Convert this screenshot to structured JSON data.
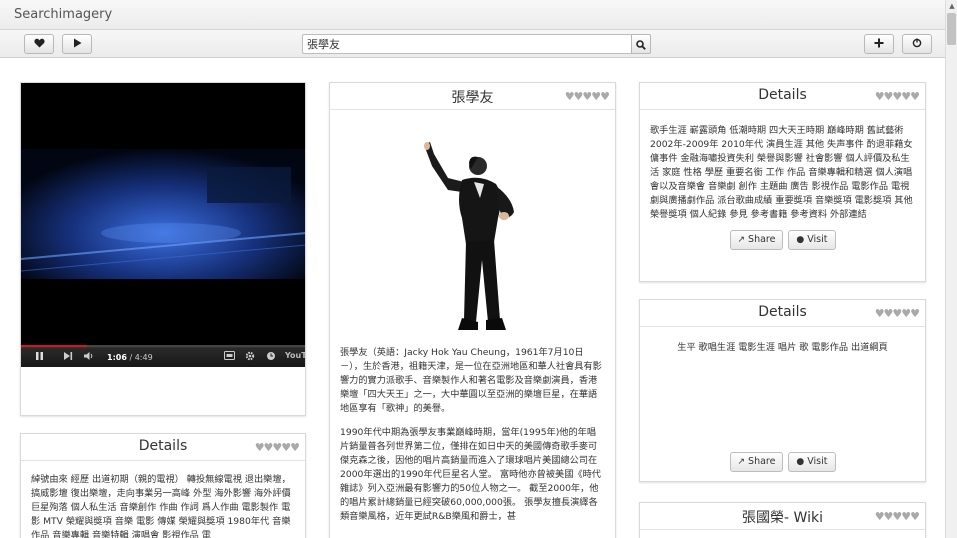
{
  "app": {
    "title": "Searchimagery"
  },
  "toolbar": {
    "like_icon": "heart-icon",
    "play_icon": "play-icon",
    "search_value": "張學友",
    "search_icon": "search-icon",
    "add_icon": "plus-icon",
    "power_icon": "power-icon"
  },
  "video": {
    "current_time": "1:06",
    "duration": "4:49",
    "separator": " / ",
    "progress": 0.23,
    "brand": "YouTube"
  },
  "panels": {
    "left_details": {
      "title": "Details",
      "text": "綽號由來 經歷 出道初期（親的電視） 轉投無線電視 退出樂壇，搞威影壇 復出樂壇，走向事業另一高峰 外型 海外影響 海外評價 巨星殉落 個人私生活 音樂創作 作曲 作詞 爲人作曲 電影製作 電影 MTV 榮耀與獎項 音樂 電影 傳媒 榮耀與獎項 1980年代 音樂作品 音樂專輯 音樂特輯 演唱會 影視作品 電"
    },
    "center": {
      "title": "張學友",
      "para1": "張學友（英語：Jacky Hok Yau Cheung，1961年7月10日－），生於香港，祖籍天津，是一位在亞洲地區和華人社會具有影響力的實力派歌手、音樂製作人和著名電影及音樂劇演員，香港樂壇「四大天王」之一，大中華圓以至亞洲的樂壇巨星，在華語地區享有「歌神」的美譽。",
      "para2": "1990年代中期為張學友事業巔峰時期，當年(1995年)他的年唱片銷量普各列世界第二位，僅排在如日中天的美國傳奇歌手麥可 傑克森之後，因他的唱片高銷量而進入了環球唱片美國總公司在2000年選出的1990年代巨星名人堂。 富時他亦曾被美國《時代雜誌》列入亞洲最有影響力的50位人物之一。 截至2000年，他的唱片累計總銷量已經突破60,000,000張。 張學友擅長演繹各類音樂風格，近年更試R&B樂風和爵士，甚"
    },
    "right_details_1": {
      "title": "Details",
      "text": "歌手生涯 嶄露頭角 低潮時期 四大天王時期 巔峰時期 舊試藝術 2002年-2009年 2010年代 演員生涯 其他 失声事件 酌退菲藉女傭事件 金融海嘯投資失利 榮譽與影響 社會影響 個人評價及私生活 家庭 性格 學歷 重要名銜 工作 作品 音樂專輯和精選 個人演唱會以及音樂會 音樂劇 創作 主題曲 廣告 影視作品 電影作品 電視劇與廣播劇作品 派台歌曲成績 重要獎項 音樂獎項 電影獎項 其他榮譽獎項 個人紀錄 參見 參考書籍 參考資料 外部連結",
      "share": "Share",
      "visit": "Visit"
    },
    "right_details_2": {
      "title": "Details",
      "text": "生平 歌唱生涯 電影生涯 唱片 歌 電影作品 出道綱頁",
      "share": "Share",
      "visit": "Visit"
    },
    "right_wiki": {
      "title": "張國榮- Wiki"
    }
  },
  "rating": {
    "hearts": "♥♥♥♥♥"
  },
  "colors": {
    "heart": "#a9a9a9",
    "video_progress": "#cc181e"
  }
}
